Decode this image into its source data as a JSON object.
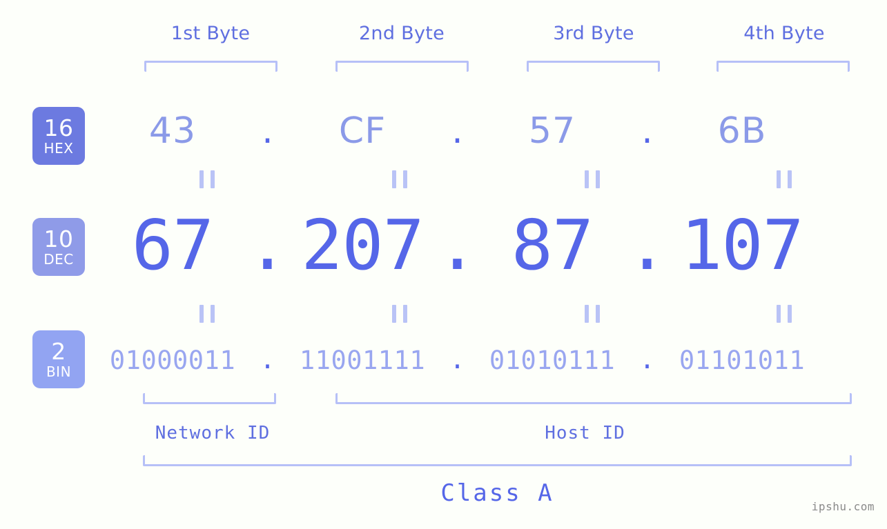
{
  "background_color": "#fdfffa",
  "accent_colors": {
    "strong_blue": "#5566e8",
    "mid_blue": "#8b9ae8",
    "light_blue": "#99a6f0",
    "bracket": "#b6c0f7",
    "equals": "#b9c3f6",
    "badge_hex": "#6c7ae0",
    "badge_dec": "#8f9be8",
    "badge_bin": "#92a4f2",
    "watermark": "#8a8a8a"
  },
  "header": {
    "byte_labels": [
      "1st Byte",
      "2nd Byte",
      "3rd Byte",
      "4th Byte"
    ]
  },
  "rows": [
    {
      "id": "hex",
      "badge_number": "16",
      "badge_base": "HEX",
      "values": [
        "43",
        "CF",
        "57",
        "6B"
      ],
      "separator": "."
    },
    {
      "id": "dec",
      "badge_number": "10",
      "badge_base": "DEC",
      "values": [
        "67",
        "207",
        "87",
        "107"
      ],
      "separator": "."
    },
    {
      "id": "bin",
      "badge_number": "2",
      "badge_base": "BIN",
      "values": [
        "01000011",
        "11001111",
        "01010111",
        "01101011"
      ],
      "separator": "."
    }
  ],
  "equality_marks": {
    "symbol": "=",
    "rotated": true,
    "count_per_band": 4,
    "bands": 2
  },
  "footer": {
    "network_id_label": "Network ID",
    "host_id_label": "Host ID",
    "class_label": "Class A"
  },
  "watermark": {
    "text": "ipshu.com"
  },
  "chart_data": {
    "type": "table",
    "title": "IP address byte breakdown",
    "ip_decimal": "67.207.87.107",
    "ip_hex": "43.CF.57.6B",
    "ip_binary": "01000011.11001111.01010111.01101011",
    "ip_class": "Class A",
    "network_id_bytes": 1,
    "host_id_bytes": 3,
    "columns": [
      "1st Byte",
      "2nd Byte",
      "3rd Byte",
      "4th Byte"
    ],
    "series": [
      {
        "name": "HEX",
        "base": 16,
        "values": [
          "43",
          "CF",
          "57",
          "6B"
        ]
      },
      {
        "name": "DEC",
        "base": 10,
        "values": [
          "67",
          "207",
          "87",
          "107"
        ]
      },
      {
        "name": "BIN",
        "base": 2,
        "values": [
          "01000011",
          "11001111",
          "01010111",
          "01101011"
        ]
      }
    ]
  }
}
